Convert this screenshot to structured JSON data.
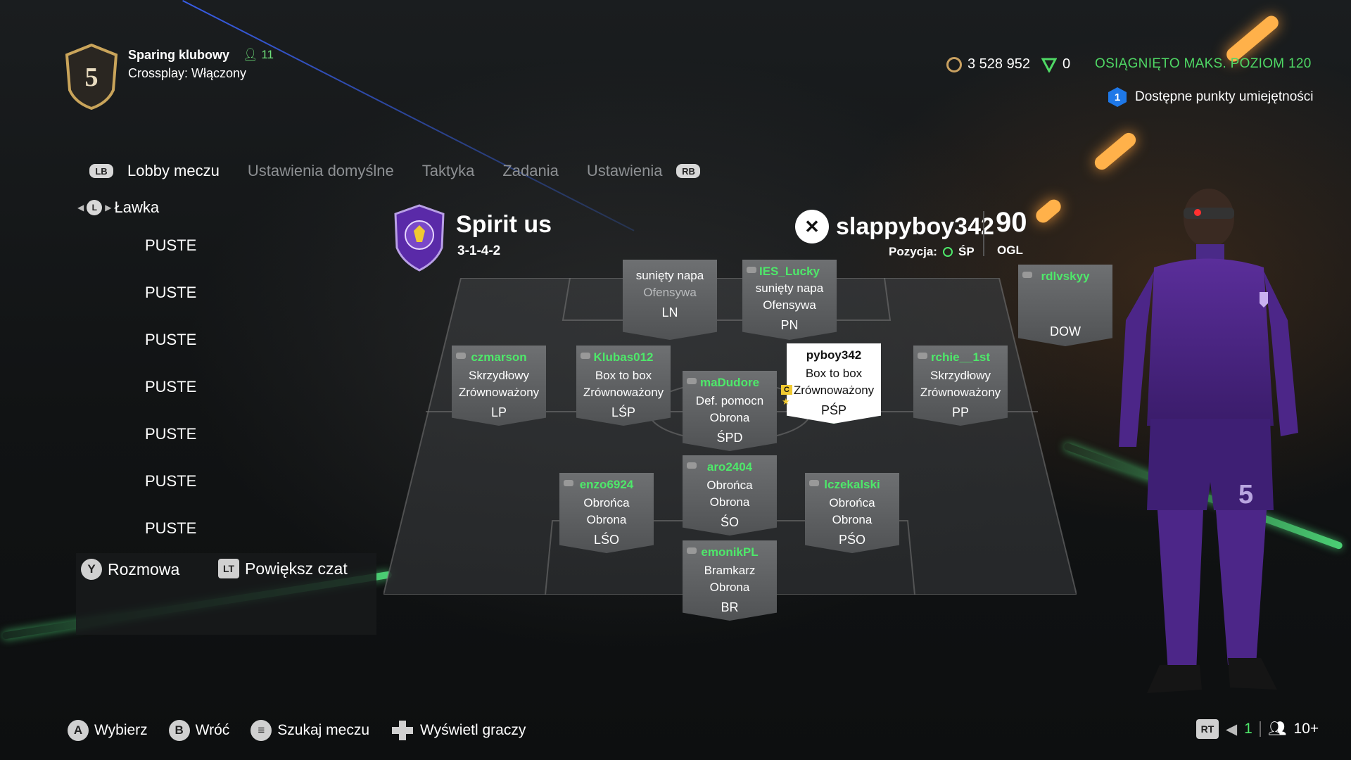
{
  "club": {
    "level": "5",
    "mode": "Sparing klubowy",
    "players_count": "11",
    "crossplay": "Crossplay: Włączony"
  },
  "currencies": {
    "coins": "3 528 952",
    "tokens": "0",
    "max_level": "OSIĄGNIĘTO MAKS. POZIOM 120",
    "skill_points_count": "1",
    "skill_points_label": "Dostępne punkty umiejętności"
  },
  "tabs": {
    "left_button": "LB",
    "right_button": "RB",
    "items": [
      "Lobby meczu",
      "Ustawienia domyślne",
      "Taktyka",
      "Zadania",
      "Ustawienia"
    ],
    "active_index": 0
  },
  "bench": {
    "stick": "L",
    "title": "Ławka",
    "items": [
      "PUSTE",
      "PUSTE",
      "PUSTE",
      "PUSTE",
      "PUSTE",
      "PUSTE",
      "PUSTE"
    ]
  },
  "chat": {
    "talk_button": "Y",
    "talk_label": "Rozmowa",
    "expand_button": "LT",
    "expand_label": "Powiększ czat"
  },
  "team": {
    "name": "Spirit us",
    "formation": "3-1-4-2"
  },
  "player": {
    "gamertag": "slappyboy342",
    "position_label": "Pozycja:",
    "position": "ŚP",
    "ovr": "90",
    "ovr_label": "OGL"
  },
  "cards": [
    {
      "id": "ln",
      "name": "",
      "line1": "sunięty napa",
      "line2": "Ofensywa",
      "pos": "LN"
    },
    {
      "id": "pn",
      "name": "IES_Lucky",
      "line1": "sunięty napa",
      "line2": "Ofensywa",
      "pos": "PN"
    },
    {
      "id": "dow",
      "name": "rdlvskyy",
      "line1": "",
      "line2": "",
      "pos": "DOW"
    },
    {
      "id": "lp",
      "name": "czmarson",
      "line1": "Skrzydłowy",
      "line2": "Zrównoważony",
      "pos": "LP"
    },
    {
      "id": "lsp",
      "name": "Klubas012",
      "line1": "Box to box",
      "line2": "Zrównoważony",
      "pos": "LŚP"
    },
    {
      "id": "sdp",
      "name": "maDudore",
      "line1": "Def. pomocn",
      "line2": "Obrona",
      "pos": "ŚPD"
    },
    {
      "id": "psp",
      "name": "pyboy342",
      "line1": "Box to box",
      "line2": "Zrównoważony",
      "pos": "PŚP"
    },
    {
      "id": "pp",
      "name": "rchie__1st",
      "line1": "Skrzydłowy",
      "line2": "Zrównoważony",
      "pos": "PP"
    },
    {
      "id": "so",
      "name": "aro2404",
      "line1": "Obrońca",
      "line2": "Obrona",
      "pos": "ŚO"
    },
    {
      "id": "lso",
      "name": "enzo6924",
      "line1": "Obrońca",
      "line2": "Obrona",
      "pos": "LŚO"
    },
    {
      "id": "pso",
      "name": "lczekalski",
      "line1": "Obrońca",
      "line2": "Obrona",
      "pos": "PŚO"
    },
    {
      "id": "br",
      "name": "emonikPL",
      "line1": "Bramkarz",
      "line2": "Obrona",
      "pos": "BR"
    }
  ],
  "captain_badge": "C",
  "footer": {
    "select_button": "A",
    "select_label": "Wybierz",
    "back_button": "B",
    "back_label": "Wróć",
    "search_label": "Szukaj meczu",
    "players_label": "Wyświetl graczy",
    "rt_button": "RT",
    "voice_count": "1",
    "lobby_count": "10+"
  },
  "colors": {
    "accent_green": "#4ee86a",
    "club_purple": "#5a2aa8"
  }
}
